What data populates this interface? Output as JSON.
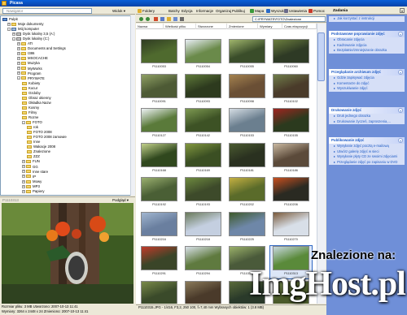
{
  "window": {
    "title": "Picasa"
  },
  "nav": {
    "combo_text": "Nawigator",
    "view_label": "Widok ▾",
    "tree": [
      {
        "label": "Pulpit",
        "level": 0,
        "icon": "desk",
        "exp": ""
      },
      {
        "label": "Moje dokumenty",
        "level": 1,
        "icon": "folder",
        "exp": "+"
      },
      {
        "label": "Mój komputer",
        "level": 1,
        "icon": "pc",
        "exp": "-"
      },
      {
        "label": "Dysk lokalny 3,5 (A:)",
        "level": 2,
        "icon": "drive",
        "exp": "+"
      },
      {
        "label": "Dysk lokalny (C:)",
        "level": 2,
        "icon": "drive",
        "exp": "-"
      },
      {
        "label": "ATI",
        "level": 3,
        "icon": "folder",
        "exp": "+"
      },
      {
        "label": "Documents and Settings",
        "level": 3,
        "icon": "folder",
        "exp": "+"
      },
      {
        "label": "I386",
        "level": 3,
        "icon": "folder",
        "exp": "+"
      },
      {
        "label": "MSOCACHE",
        "level": 3,
        "icon": "folder",
        "exp": "+"
      },
      {
        "label": "Muzyka",
        "level": 3,
        "icon": "folder",
        "exp": "+"
      },
      {
        "label": "MyWorks",
        "level": 3,
        "icon": "folder",
        "exp": "+"
      },
      {
        "label": "Program",
        "level": 3,
        "icon": "folder",
        "exp": "+"
      },
      {
        "label": "PRYWATE",
        "level": 3,
        "icon": "folder",
        "exp": "-"
      },
      {
        "label": "Kobiety",
        "level": 4,
        "icon": "folder",
        "exp": ""
      },
      {
        "label": "Kocur",
        "level": 4,
        "icon": "folder",
        "exp": ""
      },
      {
        "label": "Ozdoby",
        "level": 4,
        "icon": "folder",
        "exp": ""
      },
      {
        "label": "Obraz okienny",
        "level": 4,
        "icon": "folder",
        "exp": ""
      },
      {
        "label": "Okładka Nazw",
        "level": 4,
        "icon": "folder",
        "exp": ""
      },
      {
        "label": "Kosmy",
        "level": 4,
        "icon": "folder",
        "exp": ""
      },
      {
        "label": "Filmy",
        "level": 4,
        "icon": "folder",
        "exp": ""
      },
      {
        "label": "Rozne",
        "level": 4,
        "icon": "folder",
        "exp": ""
      },
      {
        "label": "FOTO",
        "level": 4,
        "icon": "folder",
        "exp": "-"
      },
      {
        "label": "rok",
        "level": 5,
        "icon": "folder",
        "exp": ""
      },
      {
        "label": "FOTO 2008",
        "level": 5,
        "icon": "folder",
        "exp": ""
      },
      {
        "label": "FOTO 2008 zamowie",
        "level": 5,
        "icon": "folder",
        "exp": ""
      },
      {
        "label": "Inne",
        "level": 5,
        "icon": "folder",
        "exp": ""
      },
      {
        "label": "Wakacje 2008",
        "level": 5,
        "icon": "folder",
        "exp": ""
      },
      {
        "label": "Znalezione",
        "level": 5,
        "icon": "folder",
        "exp": ""
      },
      {
        "label": "ZZZ",
        "level": 5,
        "icon": "folder",
        "exp": ""
      },
      {
        "label": "FUN",
        "level": 4,
        "icon": "folder",
        "exp": "+"
      },
      {
        "label": "GG",
        "level": 4,
        "icon": "folder",
        "exp": "+"
      },
      {
        "label": "Inne stare",
        "level": 4,
        "icon": "folder",
        "exp": "+"
      },
      {
        "label": "IP",
        "level": 4,
        "icon": "folder",
        "exp": "+"
      },
      {
        "label": "Mowy",
        "level": 4,
        "icon": "folder",
        "exp": "+"
      },
      {
        "label": "MP3",
        "level": 4,
        "icon": "folder",
        "exp": "+"
      },
      {
        "label": "Papiery",
        "level": 4,
        "icon": "folder",
        "exp": "+"
      }
    ]
  },
  "preview": {
    "title": "P1110313",
    "view_label": "Podgląd ▾",
    "status_line1": "Rozmiar pliku: 3 MB     Utworzono: 2007-10-13 11:41",
    "status_line2": "Wymiary: 3264 x 2448 x 24    Zmieniono: 2007-10-13 11:41"
  },
  "toolbar": {
    "items": [
      "Foldery",
      "Batchy",
      "Edycja",
      "Informacje",
      "Organizuj",
      "Publikuj",
      "Mapa",
      "Wyszukaj",
      "Ustawienia",
      "Pomoc"
    ]
  },
  "address": {
    "text": "C:\\PRYWATE\\FOTO\\Znalezione"
  },
  "columns": [
    "Nazwa",
    "Wielkość pliku",
    "Stworzone",
    "Zmienione",
    "Wymiary",
    "Czas ekspozycji"
  ],
  "thumbs": [
    {
      "caption": "P1110053",
      "c1": "#4f6a2e",
      "c2": "#2f3b22"
    },
    {
      "caption": "P1110054",
      "c1": "#6a8a4a",
      "c2": "#e8eef5"
    },
    {
      "caption": "P1110055",
      "c1": "#3a4d2a",
      "c2": "#a0b56d"
    },
    {
      "caption": "P1110060",
      "c1": "#2e3a25",
      "c2": "#6d7f3f"
    },
    {
      "caption": "P1110091",
      "c1": "#4d5a35",
      "c2": "#8fa064"
    },
    {
      "caption": "P1110093",
      "c1": "#2d3a1e",
      "c2": "#5f7a3a"
    },
    {
      "caption": "P1110098",
      "c1": "#6a4f35",
      "c2": "#a4824f"
    },
    {
      "caption": "P1110102",
      "c1": "#4a3b2a",
      "c2": "#6f7d4a"
    },
    {
      "caption": "P1110127",
      "c1": "#5a7a3a",
      "c2": "#eef2f5"
    },
    {
      "caption": "P1110142",
      "c1": "#3d5225",
      "c2": "#7e9a52"
    },
    {
      "caption": "P1110153",
      "c1": "#6b7f8f",
      "c2": "#d5dde4"
    },
    {
      "caption": "P1110155",
      "c1": "#2b3a1e",
      "c2": "#a02520"
    },
    {
      "caption": "P1110168",
      "c1": "#30481e",
      "c2": "#c1d08a"
    },
    {
      "caption": "P1110169",
      "c1": "#3b4f23",
      "c2": "#82983f"
    },
    {
      "caption": "P1110181",
      "c1": "#2a3120",
      "c2": "#4a5a30"
    },
    {
      "caption": "P1110186",
      "c1": "#5b4a3a",
      "c2": "#c9b8a0"
    },
    {
      "caption": "P1110192",
      "c1": "#4a5f35",
      "c2": "#9bb070"
    },
    {
      "caption": "P1110193",
      "c1": "#3d4a2a",
      "c2": "#6e8a3f"
    },
    {
      "caption": "P1110202",
      "c1": "#5a6b2a",
      "c2": "#c4b042"
    },
    {
      "caption": "P1110206",
      "c1": "#2a2a22",
      "c2": "#c95020"
    },
    {
      "caption": "P1110216",
      "c1": "#6a7f9f",
      "c2": "#a0b5cf"
    },
    {
      "caption": "P1110218",
      "c1": "#c4cfe0",
      "c2": "#6a7a5a"
    },
    {
      "caption": "P1110225",
      "c1": "#6e87a8",
      "c2": "#3e5a2a"
    },
    {
      "caption": "P1110270",
      "c1": "#d8dfe8",
      "c2": "#7a5a3a"
    },
    {
      "caption": "P1110291",
      "c1": "#3a4528",
      "c2": "#c03a2a"
    },
    {
      "caption": "P1110294",
      "c1": "#5f7a3f",
      "c2": "#d8e0e8"
    },
    {
      "caption": "P1110311",
      "c1": "#4a5a3a",
      "c2": "#9ab06a"
    },
    {
      "caption": "P1110313",
      "c1": "#5a8a3a",
      "c2": "#c8d8e0"
    },
    {
      "caption": "P1110315",
      "c1": "#3a4a2a",
      "c2": "#7a8a4a"
    },
    {
      "caption": "P1110317",
      "c1": "#4a3a2a",
      "c2": "#8a7a5a"
    },
    {
      "caption": "P1110320",
      "c1": "#2a3a2a",
      "c2": "#5a6a3a"
    },
    {
      "caption": "P1110322",
      "c1": "#4a5a2a",
      "c2": "#8aa05a"
    }
  ],
  "status": {
    "text": "P1110315.JPG - 1/416, F3,2, 250 100, f=7,40 mm    Wybranych obiektów: 1 (3.8 MB)"
  },
  "task_pane": {
    "title": "Zadania",
    "sections": [
      {
        "header": "",
        "links": [
          "Jak korzystać z instrukcji"
        ]
      },
      {
        "header": "Podstawowe poprawianie zdjęć",
        "links": [
          "Obracanie zdjęcia",
          "Kadrowanie zdjęcia",
          "Bezpłatnie/zmniejszanie obrazka"
        ]
      },
      {
        "header": "Przeglądanie archiwum zdjęć",
        "links": [
          "Gdzie zapisywać zdjęcia",
          "Komentarze do zdjęć",
          "Wyszukiwanie zdjęć"
        ]
      },
      {
        "header": "Drukowanie zdjęć",
        "links": [
          "Druk jednego obrazka",
          "Drukowanie życzeń, zaproszenia,..."
        ]
      },
      {
        "header": "Publikowanie zdjęć",
        "links": [
          "Wysyłanie zdjęć pocztą e-mailową",
          "Utwórz galerię zdjęć w sieci",
          "Wysyłanie płyty CD ze swoimi zdjęciami",
          "Przeglądanie zdjęć po zapisaniu w DVD"
        ]
      }
    ]
  },
  "watermark": {
    "line1": "Znalezione na:",
    "line2": "ImgHost.pl"
  }
}
